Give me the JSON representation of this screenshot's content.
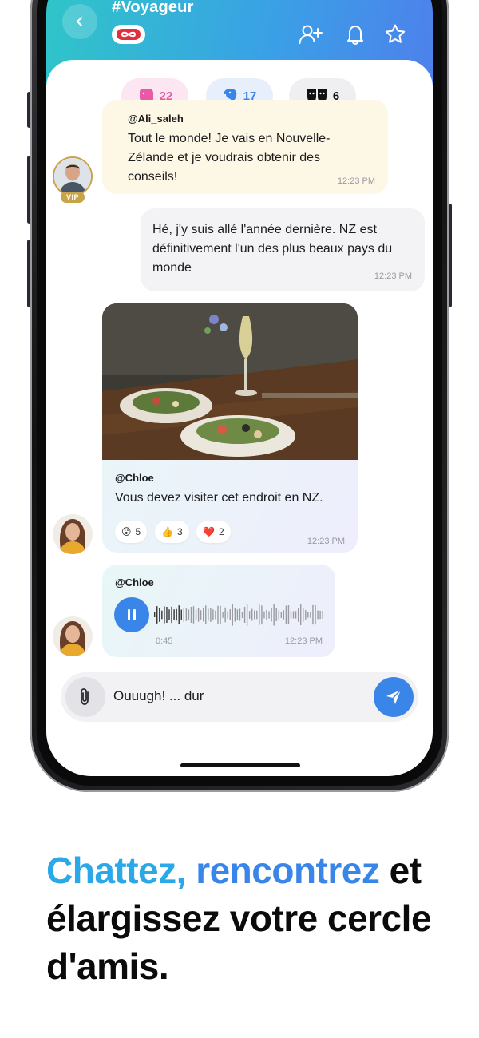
{
  "header": {
    "channel": "#Voyageur",
    "badge_icon": "infinity-icon"
  },
  "counters": [
    {
      "icon": "elephant-icon",
      "count": "22",
      "color": "#e85aa6",
      "bg": "#fce6f1"
    },
    {
      "icon": "bird-icon",
      "count": "17",
      "color": "#3a86e8",
      "bg": "#e6effb"
    },
    {
      "icon": "masks-icon",
      "count": "6",
      "color": "#111111",
      "bg": "#efeff1"
    }
  ],
  "messages": [
    {
      "author": "@Ali_saleh",
      "text": "Tout le monde! Je vais en Nouvelle-Zélande et je voudrais obtenir des conseils!",
      "time": "12:23 PM",
      "badge": "VIP"
    },
    {
      "text": "Hé, j'y suis allé l'année dernière. NZ est définitivement l'un des plus beaux pays du monde",
      "time": "12:23 PM"
    },
    {
      "author": "@Chloe",
      "text": "Vous devez visiter cet endroit en NZ.",
      "time": "12:23 PM",
      "reactions": [
        {
          "emoji": "😮",
          "count": "5"
        },
        {
          "emoji": "👍",
          "count": "3"
        },
        {
          "emoji": "❤️",
          "count": "2"
        }
      ]
    },
    {
      "author": "@Chloe",
      "duration": "0:45",
      "time": "12:23 PM"
    }
  ],
  "composer": {
    "value": "Ouuugh! ... dur"
  },
  "tagline": {
    "part1": "Chattez,",
    "part2": "rencontrez",
    "part3": "et élargissez votre cercle d'amis."
  },
  "colors": {
    "accent": "#3a86e8",
    "accent_light": "#2aa8e8",
    "header_gradient_start": "#2fc6c8",
    "header_gradient_end": "#5b6af0"
  }
}
